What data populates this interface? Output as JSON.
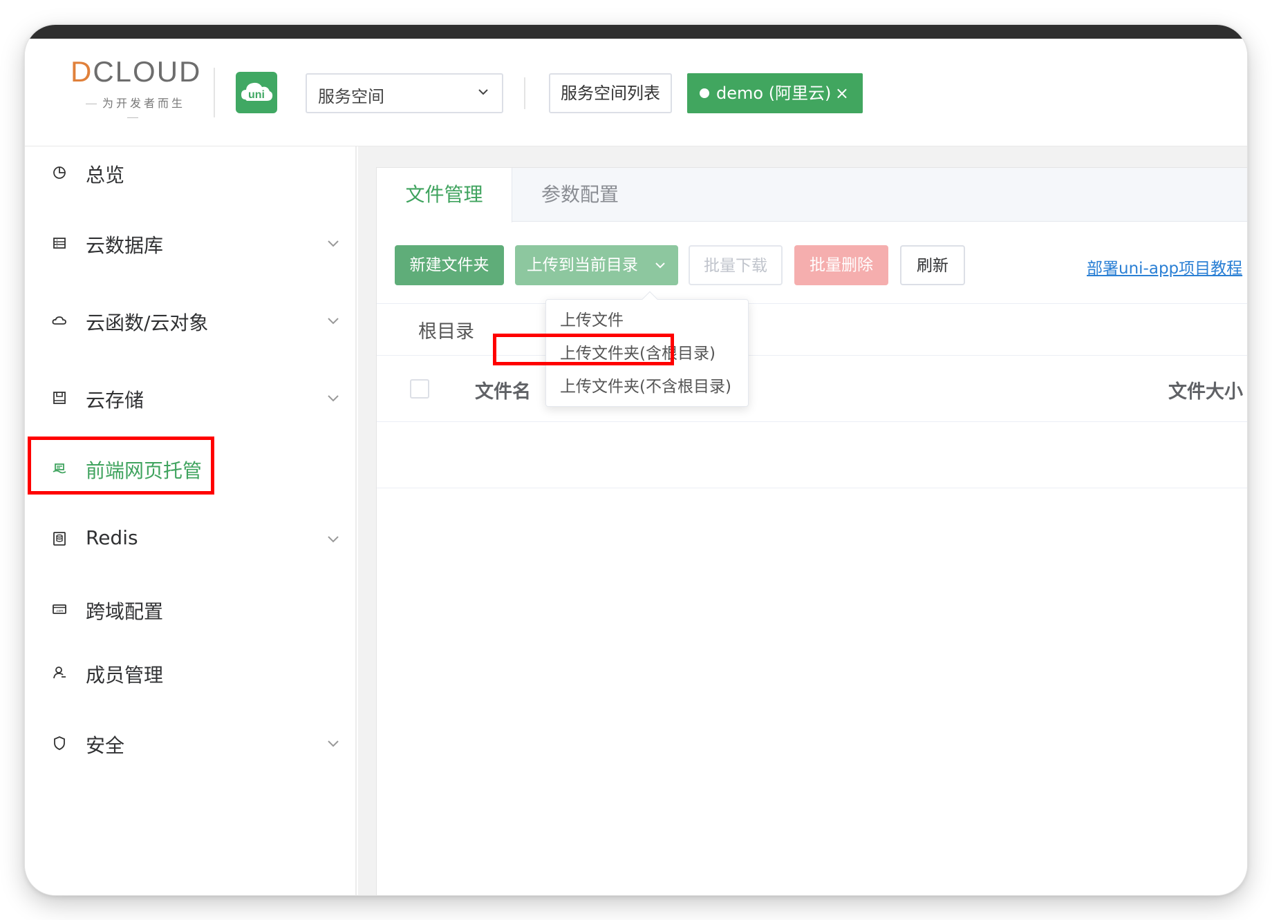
{
  "header": {
    "logo_text_mark": "D",
    "logo_text_rest": "CLOUD",
    "logo_slogan": "为开发者而生",
    "uni_badge_label": "uni",
    "space_select_value": "服务空间",
    "space_list_button": "服务空间列表",
    "env_tag_label": "demo (阿里云)",
    "env_tag_close": "×"
  },
  "sidebar": {
    "items": [
      {
        "label": "总览",
        "icon": "pie-chart-icon"
      },
      {
        "label": "云数据库",
        "icon": "database-icon"
      },
      {
        "label": "云函数/云对象",
        "icon": "cloud-icon"
      },
      {
        "label": "云存储",
        "icon": "storage-icon"
      },
      {
        "label": "前端网页托管",
        "icon": "hosting-icon"
      },
      {
        "label": "Redis",
        "icon": "redis-icon"
      },
      {
        "label": "跨域配置",
        "icon": "domain-icon"
      },
      {
        "label": "成员管理",
        "icon": "user-icon"
      },
      {
        "label": "安全",
        "icon": "shield-icon"
      }
    ],
    "active_item": "前端网页托管"
  },
  "main": {
    "tabs": [
      {
        "label": "文件管理"
      },
      {
        "label": "参数配置"
      }
    ],
    "toolbar": {
      "new_folder": "新建文件夹",
      "upload_current": "上传到当前目录",
      "batch_download": "批量下载",
      "batch_delete": "批量删除",
      "refresh": "刷新",
      "tutorial_link": "部署uni-app项目教程"
    },
    "upload_menu": {
      "items": [
        {
          "label": "上传文件"
        },
        {
          "label": "上传文件夹(含根目录)"
        },
        {
          "label": "上传文件夹(不含根目录)"
        }
      ],
      "highlighted": "上传文件夹(含根目录)"
    },
    "breadcrumb": "根目录",
    "table": {
      "columns": [
        "文件名",
        "文件大小"
      ]
    }
  },
  "colors": {
    "brand_green": "#41a65f",
    "highlight_red": "#ff0000",
    "link_blue": "#2a7fd4"
  }
}
